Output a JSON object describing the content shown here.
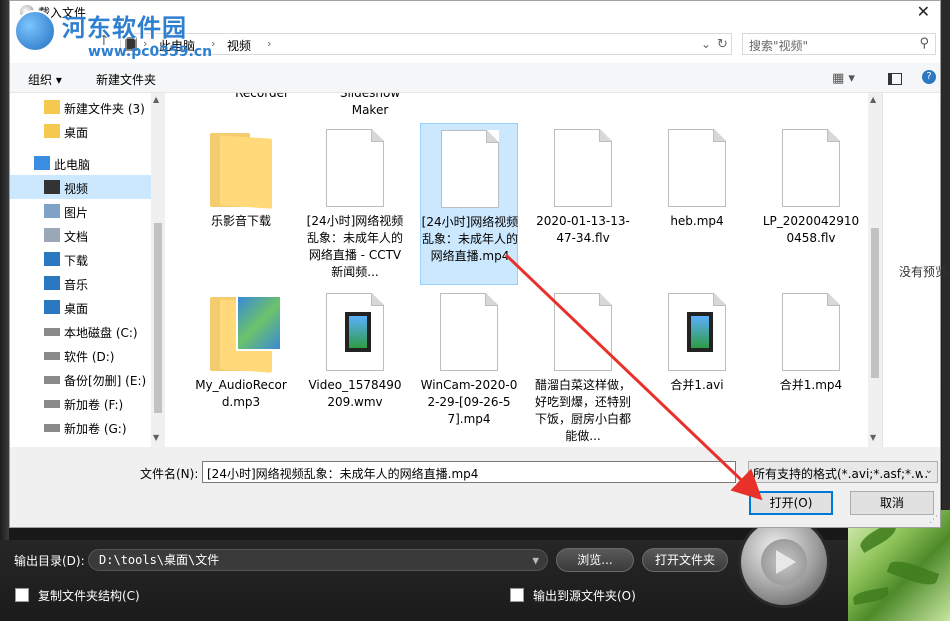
{
  "dialog": {
    "title": "载入文件",
    "close_glyph": "✕"
  },
  "watermark": {
    "text": "河东软件园",
    "url": "www.pc0359.cn"
  },
  "address": {
    "segments": [
      "此电脑",
      "视频"
    ],
    "search_placeholder": "搜索\"视频\""
  },
  "toolbar": {
    "organize": "组织 ▾",
    "new_folder": "新建文件夹"
  },
  "nav": {
    "items": [
      {
        "label": "新建文件夹 (3)",
        "icon": "folder-icon"
      },
      {
        "label": "桌面",
        "icon": "folder-icon"
      },
      {
        "label": "此电脑",
        "icon": "computer-icon"
      },
      {
        "label": "视频",
        "icon": "video-icon"
      },
      {
        "label": "图片",
        "icon": "pictures-icon"
      },
      {
        "label": "文档",
        "icon": "documents-icon"
      },
      {
        "label": "下载",
        "icon": "download-icon"
      },
      {
        "label": "音乐",
        "icon": "music-icon"
      },
      {
        "label": "桌面",
        "icon": "desktop-icon"
      },
      {
        "label": "本地磁盘 (C:)",
        "icon": "drive-icon"
      },
      {
        "label": "软件 (D:)",
        "icon": "drive-icon"
      },
      {
        "label": "备份[勿删] (E:)",
        "icon": "drive-icon"
      },
      {
        "label": "新加卷 (F:)",
        "icon": "drive-icon"
      },
      {
        "label": "新加卷 (G:)",
        "icon": "drive-icon"
      }
    ]
  },
  "files": {
    "partial_top": [
      "Recorder",
      "Slideshow",
      "Maker"
    ],
    "row1": [
      {
        "name": "乐影音下载",
        "type": "folder"
      },
      {
        "name": "[24小时]网络视频乱象：未成年人的网络直播 - CCTV 新闻频...",
        "type": "doc"
      },
      {
        "name": "[24小时]网络视频乱象：未成年人的网络直播.mp4",
        "type": "doc",
        "selected": true
      },
      {
        "name": "2020-01-13-13-47-34.flv",
        "type": "doc"
      },
      {
        "name": "heb.mp4",
        "type": "doc"
      },
      {
        "name": "LP_20200429100458.flv",
        "type": "doc"
      }
    ],
    "row2": [
      {
        "name": "My_AudioRecord.mp3",
        "type": "folder-pics"
      },
      {
        "name": "Video_1578490209.wmv",
        "type": "video"
      },
      {
        "name": "WinCam-2020-02-29-[09-26-57].mp4",
        "type": "doc"
      },
      {
        "name": "醋溜白菜这样做，好吃到爆，还特别下饭，厨房小白都能做...",
        "type": "doc"
      },
      {
        "name": "合并1.avi",
        "type": "video"
      },
      {
        "name": "合并1.mp4",
        "type": "doc"
      }
    ]
  },
  "preview": {
    "text": "没有预览。"
  },
  "form": {
    "filename_label": "文件名(N):",
    "filename_value": "[24小时]网络视频乱象：未成年人的网络直播.mp4",
    "filter_value": "所有支持的格式(*.avi;*.asf;*.wr",
    "open_label": "打开(O)",
    "cancel_label": "取消"
  },
  "app": {
    "output_label": "输出目录(D):",
    "output_path": "D:\\tools\\桌面\\文件",
    "browse_label": "浏览...",
    "open_folder_label": "打开文件夹",
    "copy_structure_label": "复制文件夹结构(C)",
    "output_to_source_label": "输出到源文件夹(O)"
  },
  "colors": {
    "selection": "#cce8ff",
    "accent": "#0078d7",
    "arrow": "#e8312a"
  }
}
